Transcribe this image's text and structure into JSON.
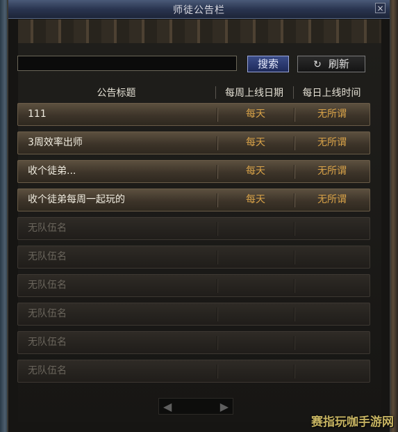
{
  "window": {
    "title": "师徒公告栏",
    "close_glyph": "×"
  },
  "search": {
    "value": "",
    "placeholder": "",
    "search_label": "搜索",
    "refresh_label": "刷新",
    "refresh_icon": "↻"
  },
  "table": {
    "headers": [
      "公告标题",
      "每周上线日期",
      "每日上线时间"
    ],
    "rows": [
      {
        "title": "111",
        "weekly": "每天",
        "daily": "无所谓",
        "filled": true
      },
      {
        "title": "3周效率出师",
        "weekly": "每天",
        "daily": "无所谓",
        "filled": true
      },
      {
        "title": "收个徒弟...",
        "weekly": "每天",
        "daily": "无所谓",
        "filled": true
      },
      {
        "title": "收个徒弟每周一起玩的",
        "weekly": "每天",
        "daily": "无所谓",
        "filled": true
      },
      {
        "title": "无队伍名",
        "weekly": "",
        "daily": "",
        "filled": false
      },
      {
        "title": "无队伍名",
        "weekly": "",
        "daily": "",
        "filled": false
      },
      {
        "title": "无队伍名",
        "weekly": "",
        "daily": "",
        "filled": false
      },
      {
        "title": "无队伍名",
        "weekly": "",
        "daily": "",
        "filled": false
      },
      {
        "title": "无队伍名",
        "weekly": "",
        "daily": "",
        "filled": false
      },
      {
        "title": "无队伍名",
        "weekly": "",
        "daily": "",
        "filled": false
      }
    ]
  },
  "pager": {
    "prev_glyph": "◀",
    "next_glyph": "▶"
  },
  "watermark": "赛指玩咖手游网",
  "colors": {
    "accent": "#d8a248",
    "title_bar": "#2a3550",
    "row_text": "#f0ece0"
  }
}
